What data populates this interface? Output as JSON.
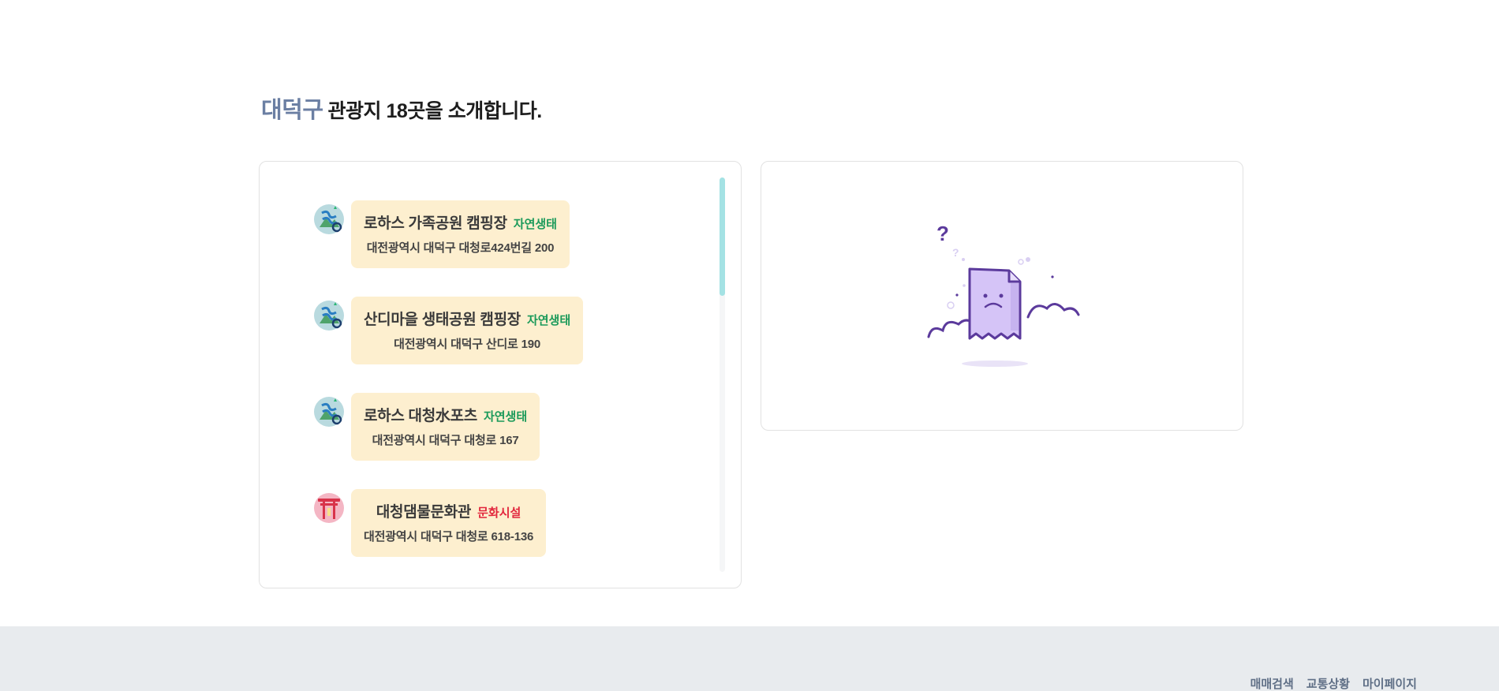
{
  "header": {
    "district": "대덕구",
    "intro": "관광지 18곳을 소개합니다."
  },
  "places": [
    {
      "name": "로하스 가족공원 캠핑장",
      "category": "자연생태",
      "category_type": "nature",
      "address": "대전광역시 대덕구 대청로424번길 200",
      "icon": "nature-map-icon"
    },
    {
      "name": "산디마을 생태공원 캠핑장",
      "category": "자연생태",
      "category_type": "nature",
      "address": "대전광역시 대덕구 산디로 190",
      "icon": "nature-map-icon"
    },
    {
      "name": "로하스 대청水포츠",
      "category": "자연생태",
      "category_type": "nature",
      "address": "대전광역시 대덕구 대청로 167",
      "icon": "nature-map-icon"
    },
    {
      "name": "대청댐물문화관",
      "category": "문화시설",
      "category_type": "culture",
      "address": "대전광역시 대덕구 대청로 618-136",
      "icon": "torii-gate-icon"
    }
  ],
  "colors": {
    "accent_district": "#6b7fa3",
    "card_bg": "#fdefcf",
    "category_nature": "#1b9a5a",
    "category_culture": "#e2263c",
    "scroll_thumb": "#a4e2e4",
    "footer_bg": "#e8ebee",
    "illustration_purple": "#5b3a9c"
  },
  "empty_state": {
    "icon": "sad-document-icon"
  },
  "footer": {
    "links": [
      "매매검색",
      "교통상황",
      "마이페이지"
    ]
  }
}
